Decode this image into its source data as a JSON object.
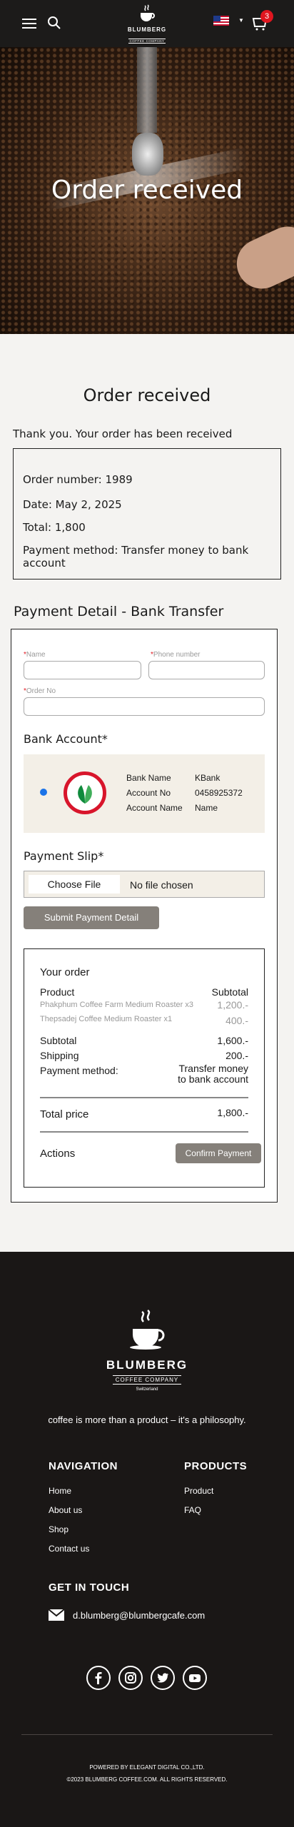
{
  "header": {
    "cart_count": "3",
    "logo": {
      "brand": "BLUMBERG",
      "sub": "COFFEE COMPANY",
      "country": "Switzerland"
    }
  },
  "hero": {
    "title": "Order received"
  },
  "order": {
    "title": "Order received",
    "thank_you": "Thank you. Your order has been received",
    "number": "Order number: 1989",
    "date": "Date: May 2, 2025",
    "total": "Total: 1,800",
    "method": "Payment method: Transfer money to bank account"
  },
  "payment": {
    "title": "Payment Detail - Bank Transfer",
    "name_label": "Name",
    "phone_label": "Phone number",
    "order_no_label": "Order No",
    "bank_account_heading": "Bank Account*",
    "bank": {
      "name_key": "Bank Name",
      "name_val": "KBank",
      "acc_no_key": "Account No",
      "acc_no_val": "0458925372",
      "acc_name_key": "Account Name",
      "acc_name_val": "Name"
    },
    "slip_heading": "Payment Slip*",
    "choose_file": "Choose File",
    "no_file": "No file chosen",
    "submit": "Submit Payment Detail"
  },
  "your_order": {
    "title": "Your order",
    "col_product": "Product",
    "col_subtotal": "Subtotal",
    "items": [
      {
        "name": "Phakphum Coffee Farm Medium Roaster x3",
        "price": "1,200.-"
      },
      {
        "name": "Thepsadej Coffee Medium Roaster x1",
        "price": "400.-"
      }
    ],
    "subtotal_label": "Subtotal",
    "subtotal_val": "1,600.-",
    "shipping_label": "Shipping",
    "shipping_val": "200.-",
    "method_label": "Payment method:",
    "method_val_1": "Transfer money",
    "method_val_2": "to bank account",
    "total_label": "Total price",
    "total_val": "1,800.-",
    "actions_label": "Actions",
    "confirm": "Confirm Payment"
  },
  "footer": {
    "logo": {
      "brand": "BLUMBERG",
      "sub": "COFFEE COMPANY",
      "country": "Switzerland"
    },
    "tagline": "coffee is more than a product – it's a philosophy.",
    "nav_heading": "NAVIGATION",
    "nav_links": [
      "Home",
      "About us",
      "Shop",
      "Contact us"
    ],
    "products_heading": "PRODUCTS",
    "product_links": [
      "Product",
      "FAQ"
    ],
    "contact_heading": "GET IN TOUCH",
    "email": "d.blumberg@blumbergcafe.com",
    "powered": "POWERED BY ELEGANT DIGITAL CO.,LTD.",
    "copyright": "©2023 BLUMBERG COFFEE.COM. ALL RIGHTS RESERVED."
  }
}
